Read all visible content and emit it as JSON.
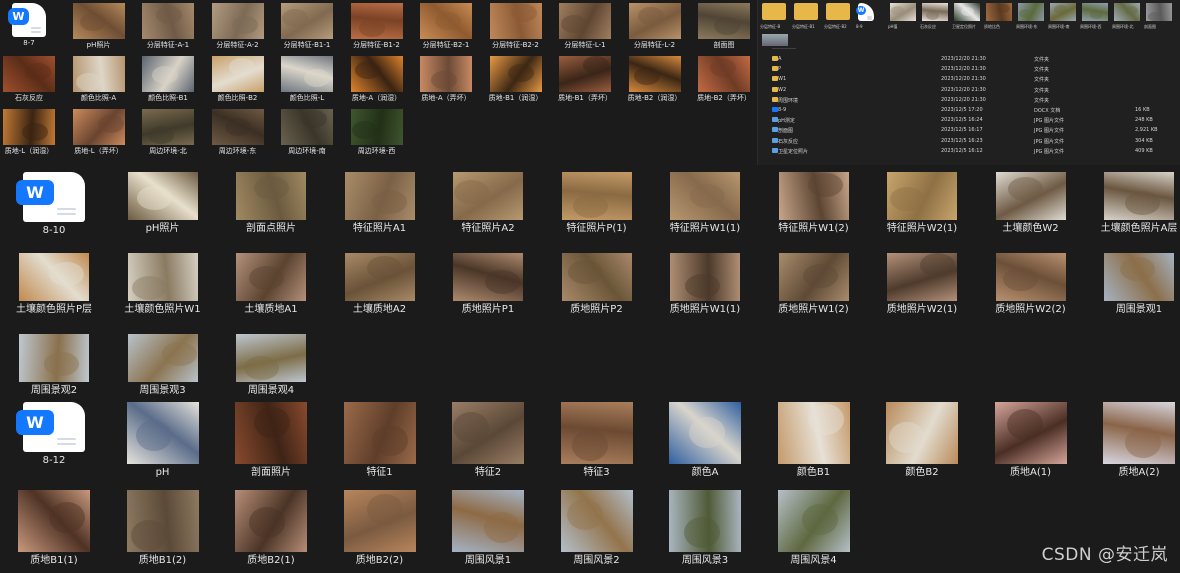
{
  "folder_8_7": {
    "items": [
      {
        "label": "8-7",
        "kind": "doc"
      },
      {
        "label": "pH照片",
        "kind": "photo",
        "palette": [
          "#b88a5c",
          "#6e4e33"
        ]
      },
      {
        "label": "分层特征-A-1",
        "kind": "photo",
        "palette": [
          "#a68a6c",
          "#6f5a47"
        ]
      },
      {
        "label": "分层特征-A-2",
        "kind": "photo",
        "palette": [
          "#b39b80",
          "#7d6a56"
        ]
      },
      {
        "label": "分层特征-B1-1",
        "kind": "photo",
        "palette": [
          "#b79c7d",
          "#80694f"
        ]
      },
      {
        "label": "分层特征-B1-2",
        "kind": "photo",
        "palette": [
          "#b96e45",
          "#7b4225"
        ]
      },
      {
        "label": "分层特征-B2-1",
        "kind": "photo",
        "palette": [
          "#c98d55",
          "#8f5a30"
        ]
      },
      {
        "label": "分层特征-B2-2",
        "kind": "photo",
        "palette": [
          "#c18859",
          "#8a5a35"
        ]
      },
      {
        "label": "分层特征-L-1",
        "kind": "photo",
        "palette": [
          "#a07f60",
          "#5f4632"
        ]
      },
      {
        "label": "分层特征-L-2",
        "kind": "photo",
        "palette": [
          "#b8926a",
          "#7a5b3e"
        ]
      },
      {
        "label": "剖面图",
        "kind": "photo",
        "palette": [
          "#8c7a5c",
          "#4f4536"
        ]
      },
      {
        "label": "石灰反应",
        "kind": "photo",
        "palette": [
          "#a0502e",
          "#5a2c18"
        ]
      },
      {
        "label": "颜色比照-A",
        "kind": "photo",
        "palette": [
          "#b5946f",
          "#ded6c8"
        ]
      },
      {
        "label": "颜色比照-B1",
        "kind": "photo",
        "palette": [
          "#5a6470",
          "#d9d3c7"
        ]
      },
      {
        "label": "颜色比照-B2",
        "kind": "photo",
        "palette": [
          "#c9a06a",
          "#e3ddd0"
        ]
      },
      {
        "label": "颜色比照-L",
        "kind": "photo",
        "palette": [
          "#6d7680",
          "#dcd6ca"
        ]
      },
      {
        "label": "质地-A（润湿）",
        "kind": "photo",
        "palette": [
          "#e0842d",
          "#3a2312"
        ]
      },
      {
        "label": "质地-A（弄坏）",
        "kind": "photo",
        "palette": [
          "#c98a63",
          "#6b4a36"
        ]
      },
      {
        "label": "质地-B1（润湿）",
        "kind": "photo",
        "palette": [
          "#e89a45",
          "#3d2713"
        ]
      },
      {
        "label": "质地-B1（弄坏）",
        "kind": "photo",
        "palette": [
          "#9b5e3f",
          "#3a2518"
        ]
      },
      {
        "label": "质地-B2（润湿）",
        "kind": "photo",
        "palette": [
          "#d98a3e",
          "#3b2614"
        ]
      },
      {
        "label": "质地-B2（弄坏）",
        "kind": "photo",
        "palette": [
          "#c46b45",
          "#6e3b25"
        ]
      },
      {
        "label": "质地-L（润湿）",
        "kind": "photo",
        "palette": [
          "#c27a35",
          "#3a2412"
        ]
      },
      {
        "label": "质地-L（弄坏）",
        "kind": "photo",
        "palette": [
          "#cc8b5c",
          "#6a4430"
        ]
      },
      {
        "label": "周边环境-北",
        "kind": "photo",
        "palette": [
          "#7a6a4e",
          "#3f3a2a"
        ]
      },
      {
        "label": "周边环境-东",
        "kind": "photo",
        "palette": [
          "#6f5a44",
          "#3b2f24"
        ]
      },
      {
        "label": "周边环境-南",
        "kind": "photo",
        "palette": [
          "#6a6250",
          "#3a3529"
        ]
      },
      {
        "label": "周边环境-西",
        "kind": "photo",
        "palette": [
          "#3f5530",
          "#223016"
        ]
      }
    ]
  },
  "explorer": {
    "top_items": [
      {
        "label": "分层特征-B",
        "kind": "folder"
      },
      {
        "label": "分层特征-B1",
        "kind": "folder"
      },
      {
        "label": "分层特征-B2",
        "kind": "folder"
      },
      {
        "label": "8-9",
        "kind": "doc"
      },
      {
        "label": "pH值",
        "kind": "photo",
        "palette": [
          "#e7e2d8",
          "#9a8d7a"
        ]
      },
      {
        "label": "石灰反应",
        "kind": "photo",
        "palette": [
          "#e8e2d6",
          "#7a6b5a"
        ]
      },
      {
        "label": "卫星定位照片",
        "kind": "photo",
        "palette": [
          "#2a3a2a",
          "#e8e8e8"
        ]
      },
      {
        "label": "质地比色",
        "kind": "photo",
        "palette": [
          "#a06a3e",
          "#5a3a22"
        ]
      },
      {
        "label": "周围环境-东",
        "kind": "photo",
        "palette": [
          "#8a9aa6",
          "#5b6a3e"
        ]
      },
      {
        "label": "周围环境-南",
        "kind": "photo",
        "palette": [
          "#9aa7b2",
          "#6a6a3a"
        ]
      },
      {
        "label": "周围环境-西",
        "kind": "photo",
        "palette": [
          "#8fa0ad",
          "#5e6b40"
        ]
      },
      {
        "label": "周围环境-北",
        "kind": "photo",
        "palette": [
          "#a0acb6",
          "#636b44"
        ]
      },
      {
        "label": "剖面图",
        "kind": "photo",
        "palette": [
          "#9a9a9a",
          "#5a5a5a"
        ]
      }
    ],
    "rows": [
      {
        "name": "A",
        "date": "2023/12/20 21:30",
        "type": "文件夹",
        "size": "",
        "icon": "folder"
      },
      {
        "name": "P",
        "date": "2023/12/20 21:30",
        "type": "文件夹",
        "size": "",
        "icon": "folder"
      },
      {
        "name": "W1",
        "date": "2023/12/20 21:30",
        "type": "文件夹",
        "size": "",
        "icon": "folder"
      },
      {
        "name": "W2",
        "date": "2023/12/20 21:30",
        "type": "文件夹",
        "size": "",
        "icon": "folder"
      },
      {
        "name": "周围环境",
        "date": "2023/12/20 21:30",
        "type": "文件夹",
        "size": "",
        "icon": "folder"
      },
      {
        "name": "8-9",
        "date": "2023/12/5 17:20",
        "type": "DOCX 文档",
        "size": "16 KB",
        "icon": "doc"
      },
      {
        "name": "pH测定",
        "date": "2023/12/5 16:24",
        "type": "JPG 图片文件",
        "size": "248 KB",
        "icon": "img"
      },
      {
        "name": "剖面图",
        "date": "2023/12/5 16:17",
        "type": "JPG 图片文件",
        "size": "2,921 KB",
        "icon": "img"
      },
      {
        "name": "石灰反应",
        "date": "2023/12/5 16:23",
        "type": "JPG 图片文件",
        "size": "304 KB",
        "icon": "img"
      },
      {
        "name": "卫星定位照片",
        "date": "2023/12/5 16:12",
        "type": "JPG 图片文件",
        "size": "409 KB",
        "icon": "img"
      }
    ]
  },
  "folder_8_10": {
    "items": [
      {
        "label": "8-10",
        "kind": "doc"
      },
      {
        "label": "pH照片",
        "kind": "photo",
        "palette": [
          "#6b5a40",
          "#e8e0cc"
        ]
      },
      {
        "label": "剖面点照片",
        "kind": "photo",
        "palette": [
          "#a08a63",
          "#6b5a3e"
        ]
      },
      {
        "label": "特征照片A1",
        "kind": "photo",
        "palette": [
          "#a98d6a",
          "#7a6045"
        ]
      },
      {
        "label": "特征照片A2",
        "kind": "photo",
        "palette": [
          "#b79a70",
          "#85694a"
        ]
      },
      {
        "label": "特征照片P(1)",
        "kind": "photo",
        "palette": [
          "#c39a67",
          "#8a6a42"
        ]
      },
      {
        "label": "特征照片W1(1)",
        "kind": "photo",
        "palette": [
          "#b99770",
          "#866a4c"
        ]
      },
      {
        "label": "特征照片W1(2)",
        "kind": "photo",
        "palette": [
          "#c8a58a",
          "#5b4532"
        ]
      },
      {
        "label": "特征照片W2(1)",
        "kind": "photo",
        "palette": [
          "#c9a56c",
          "#8d7044"
        ]
      },
      {
        "label": "土壤颜色W2",
        "kind": "photo",
        "palette": [
          "#e0dcd2",
          "#6e5a44"
        ]
      },
      {
        "label": "土壤颜色照片A层",
        "kind": "photo",
        "palette": [
          "#d8d3c8",
          "#6a5640"
        ]
      },
      {
        "label": "土壤颜色照片P层",
        "kind": "photo",
        "palette": [
          "#c08a4e",
          "#e3ddd0"
        ]
      },
      {
        "label": "土壤颜色照片W1",
        "kind": "photo",
        "palette": [
          "#d6d0c2",
          "#8a7a62"
        ]
      },
      {
        "label": "土壤质地A1",
        "kind": "photo",
        "palette": [
          "#b4917a",
          "#5a4330"
        ]
      },
      {
        "label": "土壤质地A2",
        "kind": "photo",
        "palette": [
          "#a88a66",
          "#6a5238"
        ]
      },
      {
        "label": "质地照片P1",
        "kind": "photo",
        "palette": [
          "#ad8a6f",
          "#4a3627"
        ]
      },
      {
        "label": "质地照片P2",
        "kind": "photo",
        "palette": [
          "#a98a6a",
          "#6a5538"
        ]
      },
      {
        "label": "质地照片W1(1)",
        "kind": "photo",
        "palette": [
          "#b08f74",
          "#4b392a"
        ]
      },
      {
        "label": "质地照片W1(2)",
        "kind": "photo",
        "palette": [
          "#a98c6c",
          "#5e4a35"
        ]
      },
      {
        "label": "质地照片W2(1)",
        "kind": "photo",
        "palette": [
          "#b4917a",
          "#4e3b2c"
        ]
      },
      {
        "label": "质地照片W2(2)",
        "kind": "photo",
        "palette": [
          "#b99070",
          "#6b5038"
        ]
      },
      {
        "label": "周围景观1",
        "kind": "photo",
        "palette": [
          "#a5b3c2",
          "#8c6f4a"
        ]
      },
      {
        "label": "周围景观2",
        "kind": "photo",
        "palette": [
          "#bfc8d0",
          "#8a704c"
        ]
      },
      {
        "label": "周围景观3",
        "kind": "photo",
        "palette": [
          "#b8c2cb",
          "#8b7450"
        ]
      },
      {
        "label": "周围景观4",
        "kind": "photo",
        "palette": [
          "#bdc6cf",
          "#7d6d48"
        ]
      }
    ]
  },
  "folder_8_12": {
    "items": [
      {
        "label": "8-12",
        "kind": "doc"
      },
      {
        "label": "pH",
        "kind": "photo",
        "palette": [
          "#e6e3dc",
          "#5a6c8a"
        ]
      },
      {
        "label": "剖面照片",
        "kind": "photo",
        "palette": [
          "#8a4a2e",
          "#3e2416"
        ]
      },
      {
        "label": "特征1",
        "kind": "photo",
        "palette": [
          "#9b6a4a",
          "#5e3e2a"
        ]
      },
      {
        "label": "特征2",
        "kind": "photo",
        "palette": [
          "#9a7e66",
          "#5a4837"
        ]
      },
      {
        "label": "特征3",
        "kind": "photo",
        "palette": [
          "#a97e5c",
          "#6b4a32"
        ]
      },
      {
        "label": "颜色A",
        "kind": "photo",
        "palette": [
          "#2f5fa0",
          "#d9d5cc"
        ]
      },
      {
        "label": "颜色B1",
        "kind": "photo",
        "palette": [
          "#c49a6a",
          "#e7e1d6"
        ]
      },
      {
        "label": "颜色B2",
        "kind": "photo",
        "palette": [
          "#b98a5a",
          "#e2dccf"
        ]
      },
      {
        "label": "质地A(1)",
        "kind": "photo",
        "palette": [
          "#d6a59a",
          "#4a2e24"
        ]
      },
      {
        "label": "质地A(2)",
        "kind": "photo",
        "palette": [
          "#d8d6e0",
          "#8a6448"
        ]
      },
      {
        "label": "质地B1(1)",
        "kind": "photo",
        "palette": [
          "#c9997e",
          "#4e3224"
        ]
      },
      {
        "label": "质地B1(2)",
        "kind": "photo",
        "palette": [
          "#8f7a62",
          "#5a4a38"
        ]
      },
      {
        "label": "质地B2(1)",
        "kind": "photo",
        "palette": [
          "#b88e78",
          "#4a3426"
        ]
      },
      {
        "label": "质地B2(2)",
        "kind": "photo",
        "palette": [
          "#b8865c",
          "#7a5a40"
        ]
      },
      {
        "label": "周围风景1",
        "kind": "photo",
        "palette": [
          "#a4b3c4",
          "#8e6a45"
        ]
      },
      {
        "label": "周围风景2",
        "kind": "photo",
        "palette": [
          "#b3bfcb",
          "#93744c"
        ]
      },
      {
        "label": "周围风景3",
        "kind": "photo",
        "palette": [
          "#aab6c0",
          "#4f5a36"
        ]
      },
      {
        "label": "周围风景4",
        "kind": "photo",
        "palette": [
          "#b5c0c8",
          "#5e6840"
        ]
      }
    ]
  },
  "watermark": "CSDN @安迁岚",
  "colors": {
    "background": "#1b1b1b",
    "word_blue": "#1478ff",
    "folder_yellow": "#e6b84a"
  }
}
